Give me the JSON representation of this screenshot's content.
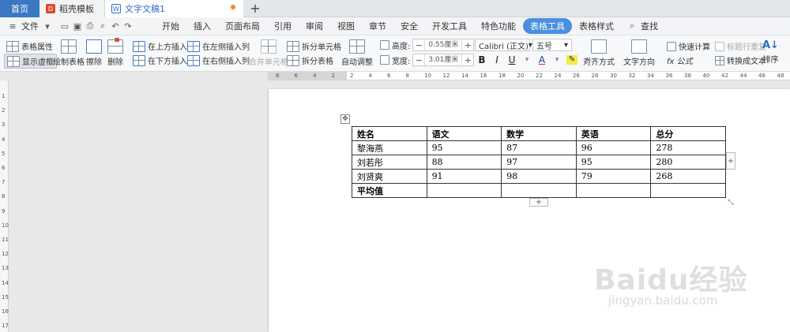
{
  "tabs": {
    "home": "首页",
    "template": "稻壳模板",
    "doc": "文字文稿1",
    "add": "+"
  },
  "menubar": {
    "file": "文件",
    "items": [
      "开始",
      "插入",
      "页面布局",
      "引用",
      "审阅",
      "视图",
      "章节",
      "安全",
      "开发工具",
      "特色功能",
      "表格工具",
      "表格样式"
    ],
    "active_index": 10,
    "search": "查找"
  },
  "ribbon": {
    "table_props": "表格属性",
    "show_gridlines": "显示虚框",
    "draw_table": "绘制表格",
    "erase": "擦除",
    "delete": "删除",
    "insert_above": "在上方插入行",
    "insert_below": "在下方插入行",
    "insert_left": "在左侧插入列",
    "insert_right": "在右侧插入列",
    "merge_cells": "合并单元格",
    "split_cells": "拆分单元格",
    "split_table": "拆分表格",
    "autofit": "自动调整",
    "height_label": "高度:",
    "height_value": "0.55厘米",
    "width_label": "宽度:",
    "width_value": "3.01厘米",
    "font_name": "Calibri (正文)",
    "font_size": "五号",
    "bold": "B",
    "italic": "I",
    "underline": "U",
    "font_color": "A",
    "align": "对齐方式",
    "text_direction": "文字方向",
    "quick_calc": "快速计算",
    "repeat_header": "标题行重复",
    "formula": "fx 公式",
    "to_text": "转换成文本",
    "sort": "排序"
  },
  "ruler": {
    "h_marks": [
      "8",
      "6",
      "4",
      "2",
      "2",
      "4",
      "6",
      "8",
      "10",
      "12",
      "14",
      "16",
      "18",
      "20",
      "22",
      "24",
      "26",
      "28",
      "30",
      "32",
      "34",
      "36",
      "38",
      "40",
      "42",
      "44",
      "46",
      "48"
    ],
    "v_marks": [
      "1",
      "2",
      "3",
      "4",
      "5",
      "6",
      "7",
      "8",
      "9",
      "10",
      "11",
      "12",
      "13",
      "14",
      "15",
      "16",
      "17"
    ]
  },
  "table": {
    "header": [
      "姓名",
      "语文",
      "数学",
      "英语",
      "总分"
    ],
    "rows": [
      [
        "黎海燕",
        "95",
        "87",
        "96",
        "278"
      ],
      [
        "刘若彤",
        "88",
        "97",
        "95",
        "280"
      ],
      [
        "刘贤爽",
        "91",
        "98",
        "79",
        "268"
      ],
      [
        "平均值",
        "",
        "",
        "",
        ""
      ]
    ]
  },
  "watermark": {
    "main": "Baidu经验",
    "sub": "jingyan.baidu.com"
  }
}
